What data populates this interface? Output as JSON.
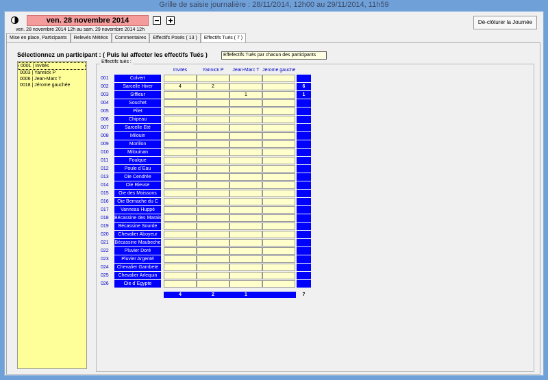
{
  "window": {
    "title": "Grille de saisie journalière : 28/11/2014, 12h00 au 29/11/2014, 11h59"
  },
  "header": {
    "date": "ven. 28 novembre 2014",
    "range": "ven. 28 novembre 2014 12h au sam. 29 novembre 2014 12h",
    "close_button": "Dé-clôturer la Journée",
    "colors": {
      "date_bg": "#f49c9c",
      "accent": "#0000ff"
    }
  },
  "tabs": [
    {
      "label": "Mise en place, Participants"
    },
    {
      "label": "Relevés Météos"
    },
    {
      "label": "Commentaires"
    },
    {
      "label": "Effectifs Posés ( 13 )"
    },
    {
      "label": "Effectifs Tués ( 7 )"
    }
  ],
  "tooltip": "Effefectifs Tués par chacun des participants",
  "instruction": "Sélectionnez un participant : ( Puis lui affecter les effectifs Tués )",
  "participants": [
    "0001 | Invités",
    "0003 | Yannick P",
    "0006 | Jean-Marc T",
    "0018 | Jérome gauchée"
  ],
  "grid": {
    "label": "Effectifs tués :",
    "columns": [
      "Invités",
      "Yannick P",
      "Jean-Marc T",
      "Jérome gauchée"
    ],
    "rows": [
      {
        "num": "001",
        "label": "Colvert",
        "values": [
          "",
          "",
          "",
          ""
        ],
        "total": ""
      },
      {
        "num": "002",
        "label": "Sarcelle Hiver",
        "values": [
          "4",
          "2",
          "",
          ""
        ],
        "total": "6"
      },
      {
        "num": "003",
        "label": "Siffleur",
        "values": [
          "",
          "",
          "1",
          ""
        ],
        "total": "1"
      },
      {
        "num": "004",
        "label": "Souchet",
        "values": [
          "",
          "",
          "",
          ""
        ],
        "total": ""
      },
      {
        "num": "005",
        "label": "Pilet",
        "values": [
          "",
          "",
          "",
          ""
        ],
        "total": ""
      },
      {
        "num": "006",
        "label": "Chipeau",
        "values": [
          "",
          "",
          "",
          ""
        ],
        "total": ""
      },
      {
        "num": "007",
        "label": "Sarcelle Eté",
        "values": [
          "",
          "",
          "",
          ""
        ],
        "total": ""
      },
      {
        "num": "008",
        "label": "Milouin",
        "values": [
          "",
          "",
          "",
          ""
        ],
        "total": ""
      },
      {
        "num": "009",
        "label": "Morillon",
        "values": [
          "",
          "",
          "",
          ""
        ],
        "total": ""
      },
      {
        "num": "010",
        "label": "Milouinan",
        "values": [
          "",
          "",
          "",
          ""
        ],
        "total": ""
      },
      {
        "num": "011",
        "label": "Foulque",
        "values": [
          "",
          "",
          "",
          ""
        ],
        "total": ""
      },
      {
        "num": "012",
        "label": "Poule d`Eau",
        "values": [
          "",
          "",
          "",
          ""
        ],
        "total": ""
      },
      {
        "num": "013",
        "label": "Oie Cendrée",
        "values": [
          "",
          "",
          "",
          ""
        ],
        "total": ""
      },
      {
        "num": "014",
        "label": "Oie Rieuse",
        "values": [
          "",
          "",
          "",
          ""
        ],
        "total": ""
      },
      {
        "num": "015",
        "label": "Oie des Moissons",
        "values": [
          "",
          "",
          "",
          ""
        ],
        "total": ""
      },
      {
        "num": "016",
        "label": "Oie Bernache du C",
        "values": [
          "",
          "",
          "",
          ""
        ],
        "total": ""
      },
      {
        "num": "017",
        "label": "Vanneau Huppé",
        "values": [
          "",
          "",
          "",
          ""
        ],
        "total": ""
      },
      {
        "num": "018",
        "label": "Bécassine des Marais",
        "values": [
          "",
          "",
          "",
          ""
        ],
        "total": ""
      },
      {
        "num": "019",
        "label": "Bécassine Sourde",
        "values": [
          "",
          "",
          "",
          ""
        ],
        "total": ""
      },
      {
        "num": "020",
        "label": "Chevalier Aboyeur",
        "values": [
          "",
          "",
          "",
          ""
        ],
        "total": ""
      },
      {
        "num": "021",
        "label": "Bécassine Maubeche",
        "values": [
          "",
          "",
          "",
          ""
        ],
        "total": ""
      },
      {
        "num": "022",
        "label": "Pluvier Doré",
        "values": [
          "",
          "",
          "",
          ""
        ],
        "total": ""
      },
      {
        "num": "023",
        "label": "Pluvier Argenté",
        "values": [
          "",
          "",
          "",
          ""
        ],
        "total": ""
      },
      {
        "num": "024",
        "label": "Chevalier Gambete",
        "values": [
          "",
          "",
          "",
          ""
        ],
        "total": ""
      },
      {
        "num": "025",
        "label": "Chevalier Arlequin",
        "values": [
          "",
          "",
          "",
          ""
        ],
        "total": ""
      },
      {
        "num": "026",
        "label": "Oie d`Egypte",
        "values": [
          "",
          "",
          "",
          ""
        ],
        "total": ""
      }
    ],
    "column_totals": [
      "4",
      "2",
      "1",
      ""
    ],
    "grand_total": "7"
  }
}
